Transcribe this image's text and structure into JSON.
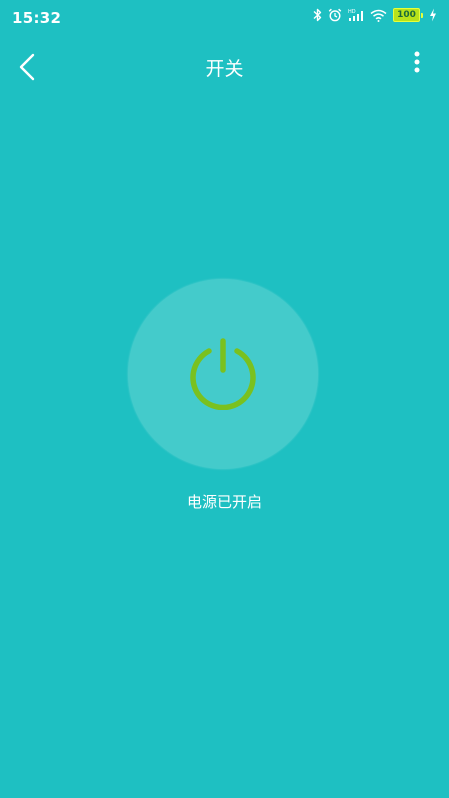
{
  "status_bar": {
    "time": "15:32",
    "battery_level": "100",
    "battery_color": "#b8e21a",
    "icons": [
      "bluetooth-icon",
      "alarm-icon",
      "hd-signal-icon",
      "wifi-icon",
      "battery-icon",
      "charging-icon"
    ]
  },
  "nav": {
    "title": "开关",
    "back_icon": "chevron-left-icon",
    "more_icon": "more-vertical-icon"
  },
  "power": {
    "status_text": "电源已开启",
    "icon_color": "#7ac11f",
    "circle_color": "#44cbcb"
  },
  "theme": {
    "background": "#1ec0c2"
  }
}
